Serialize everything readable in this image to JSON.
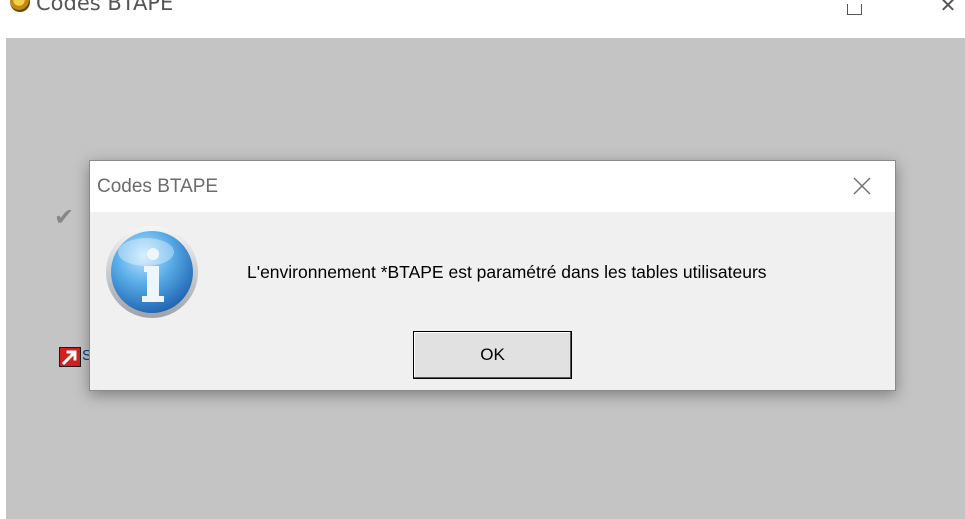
{
  "parent_window": {
    "title": "Codes BTAPE",
    "controls": {
      "maximize_icon": "maximize-icon",
      "close_icon": "close-icon"
    },
    "body_color": "#c4c4c4",
    "items": [
      {
        "icon": "checkmark-icon"
      },
      {
        "icon": "shortcut-arrow-icon",
        "label": "S"
      }
    ]
  },
  "dialog": {
    "title": "Codes BTAPE",
    "icon": "information-icon",
    "message": "L'environnement *BTAPE est paramétré dans les tables utilisateurs",
    "ok_label": "OK",
    "colors": {
      "title_bar": "#ffffff",
      "body": "#f0f0f0",
      "button": "#e1e1e1"
    }
  }
}
